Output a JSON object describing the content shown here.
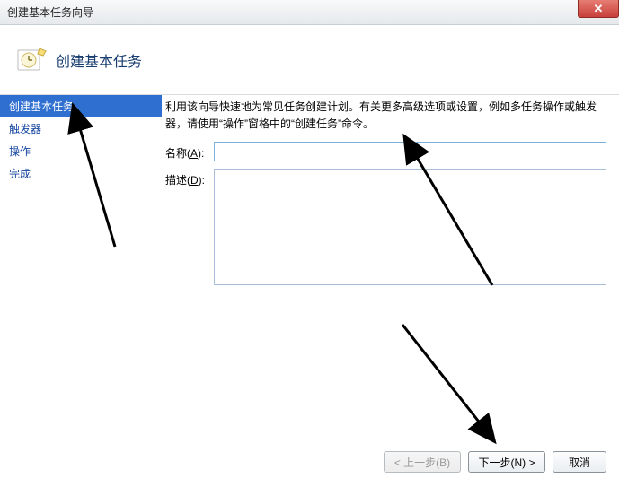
{
  "window": {
    "title": "创建基本任务向导"
  },
  "header": {
    "title": "创建基本任务"
  },
  "sidebar": {
    "items": [
      {
        "label": "创建基本任务",
        "selected": true
      },
      {
        "label": "触发器",
        "selected": false
      },
      {
        "label": "操作",
        "selected": false
      },
      {
        "label": "完成",
        "selected": false
      }
    ]
  },
  "content": {
    "description": "利用该向导快速地为常见任务创建计划。有关更多高级选项或设置，例如多任务操作或触发器，请使用“操作”窗格中的“创建任务”命令。",
    "name_label_prefix": "名称(",
    "name_label_key": "A",
    "name_label_suffix": "):",
    "desc_label_prefix": "描述(",
    "desc_label_key": "D",
    "desc_label_suffix": "):",
    "name_value": "",
    "desc_value": ""
  },
  "footer": {
    "back_label": "< 上一步(B)",
    "next_label": "下一步(N) >",
    "cancel_label": "取消"
  }
}
